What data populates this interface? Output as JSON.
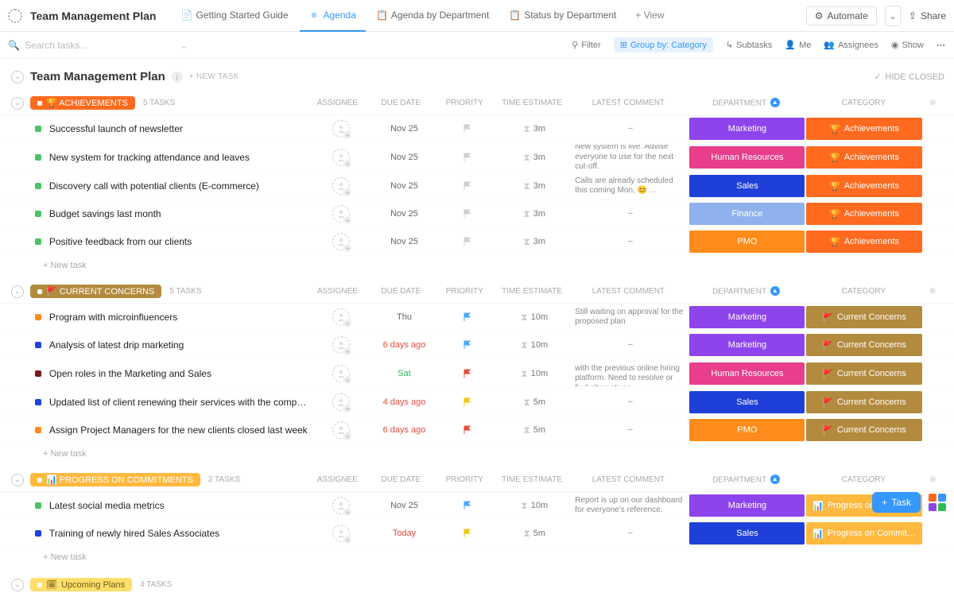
{
  "header": {
    "folder_title": "Team Management Plan",
    "tabs": [
      {
        "label": "Getting Started Guide",
        "active": false
      },
      {
        "label": "Agenda",
        "active": true
      },
      {
        "label": "Agenda by Department",
        "active": false
      },
      {
        "label": "Status by Department",
        "active": false
      }
    ],
    "add_view": "+ View",
    "automate": "Automate",
    "share": "Share"
  },
  "filterbar": {
    "search_placeholder": "Search tasks...",
    "filter": "Filter",
    "group_by": "Group by: Category",
    "subtasks": "Subtasks",
    "me": "Me",
    "assignees": "Assignees",
    "show": "Show"
  },
  "page": {
    "title": "Team Management Plan",
    "new_task": "+ NEW TASK",
    "hide_closed": "HIDE CLOSED"
  },
  "columns": {
    "assignee": "ASSIGNEE",
    "due": "DUE DATE",
    "priority": "PRIORITY",
    "est": "TIME ESTIMATE",
    "comment": "LATEST COMMENT",
    "dept": "DEPARTMENT",
    "cat": "CATEGORY"
  },
  "colors": {
    "marketing": "#8e44ec",
    "hr": "#e83e8c",
    "sales": "#1e40d8",
    "finance": "#8fb2ef",
    "pmo": "#ff8c1a",
    "achievements": "#ff6a1f",
    "concerns": "#b38b3f",
    "progress": "#ffb93e",
    "upcoming": "#ffdf6b"
  },
  "sections": [
    {
      "id": "achievements",
      "pill_label": "Achievements",
      "pill_icon": "🏆",
      "pill_bg": "#ff6a1f",
      "count": "5 TASKS",
      "cat_label": "Achievements",
      "cat_icon": "🏆",
      "cat_bg": "#ff6a1f",
      "rows": [
        {
          "bullet": "#4ac366",
          "name": "Successful launch of newsletter",
          "due": "Nov 25",
          "due_color": "#666",
          "flag": "#cfcfcf",
          "est": "3m",
          "comment": "–",
          "dept": "Marketing",
          "dept_bg": "#8e44ec"
        },
        {
          "bullet": "#4ac366",
          "name": "New system for tracking attendance and leaves",
          "due": "Nov 25",
          "due_color": "#666",
          "flag": "#cfcfcf",
          "est": "3m",
          "comment": "New system is live. Advise everyone to use for the next cut-off.",
          "dept": "Human Resources",
          "dept_bg": "#e83e8c"
        },
        {
          "bullet": "#4ac366",
          "name": "Discovery call with potential clients (E-commerce)",
          "due": "Nov 25",
          "due_color": "#666",
          "flag": "#cfcfcf",
          "est": "3m",
          "comment": "Calls are already scheduled this coming Mon. 😊 …",
          "dept": "Sales",
          "dept_bg": "#1e40d8"
        },
        {
          "bullet": "#4ac366",
          "name": "Budget savings last month",
          "due": "Nov 25",
          "due_color": "#666",
          "flag": "#cfcfcf",
          "est": "3m",
          "comment": "–",
          "dept": "Finance",
          "dept_bg": "#8fb2ef"
        },
        {
          "bullet": "#4ac366",
          "name": "Positive feedback from our clients",
          "due": "Nov 25",
          "due_color": "#666",
          "flag": "#cfcfcf",
          "est": "3m",
          "comment": "–",
          "dept": "PMO",
          "dept_bg": "#ff8c1a"
        }
      ]
    },
    {
      "id": "concerns",
      "pill_label": "Current Concerns",
      "pill_icon": "🚩",
      "pill_bg": "#b38b3f",
      "count": "5 TASKS",
      "cat_label": "Current Concerns",
      "cat_icon": "🚩",
      "cat_bg": "#b38b3f",
      "rows": [
        {
          "bullet": "#ff8c1a",
          "name": "Program with microinfluencers",
          "due": "Thu",
          "due_color": "#666",
          "flag": "#4aa8ff",
          "est": "10m",
          "comment": "Still waiting on approval for the proposed plan",
          "dept": "Marketing",
          "dept_bg": "#8e44ec"
        },
        {
          "bullet": "#1e40d8",
          "name": "Analysis of latest drip marketing",
          "due": "6 days ago",
          "due_color": "#e74c3c",
          "flag": "#4aa8ff",
          "est": "10m",
          "comment": "–",
          "dept": "Marketing",
          "dept_bg": "#8e44ec"
        },
        {
          "bullet": "#7a1d1d",
          "name": "Open roles in the Marketing and Sales",
          "due": "Sat",
          "due_color": "#2dbb54",
          "flag": "#e74c3c",
          "est": "10m",
          "comment": "We have subscription issues with the previous online hiring platform. Need to resolve or find alternatives.",
          "dept": "Human Resources",
          "dept_bg": "#e83e8c"
        },
        {
          "bullet": "#1e40d8",
          "name": "Updated list of client renewing their services with the company",
          "due": "4 days ago",
          "due_color": "#e74c3c",
          "flag": "#f1c40f",
          "est": "5m",
          "comment": "–",
          "dept": "Sales",
          "dept_bg": "#1e40d8"
        },
        {
          "bullet": "#ff8c1a",
          "name": "Assign Project Managers for the new clients closed last week",
          "due": "6 days ago",
          "due_color": "#e74c3c",
          "flag": "#e74c3c",
          "est": "5m",
          "comment": "–",
          "dept": "PMO",
          "dept_bg": "#ff8c1a"
        }
      ]
    },
    {
      "id": "progress",
      "pill_label": "Progress on Commitments",
      "pill_icon": "📊",
      "pill_bg": "#ffb93e",
      "count": "2 TASKS",
      "cat_label": "Progress on Commit…",
      "cat_icon": "📊",
      "cat_bg": "#ffb93e",
      "rows": [
        {
          "bullet": "#4ac366",
          "name": "Latest social media metrics",
          "due": "Nov 25",
          "due_color": "#666",
          "flag": "#4aa8ff",
          "est": "10m",
          "comment": "Report is up on our dashboard for everyone's reference.",
          "dept": "Marketing",
          "dept_bg": "#8e44ec"
        },
        {
          "bullet": "#1e40d8",
          "name": "Training of newly hired Sales Associates",
          "due": "Today",
          "due_color": "#e74c3c",
          "flag": "#f1c40f",
          "est": "5m",
          "comment": "–",
          "dept": "Sales",
          "dept_bg": "#1e40d8"
        }
      ]
    }
  ],
  "upcoming": {
    "pill_label": "Upcoming Plans",
    "pill_icon": "🗓",
    "pill_bg": "#ffdf6b",
    "count": "4 TASKS"
  },
  "newtask": "+ New task",
  "fab": "Task"
}
